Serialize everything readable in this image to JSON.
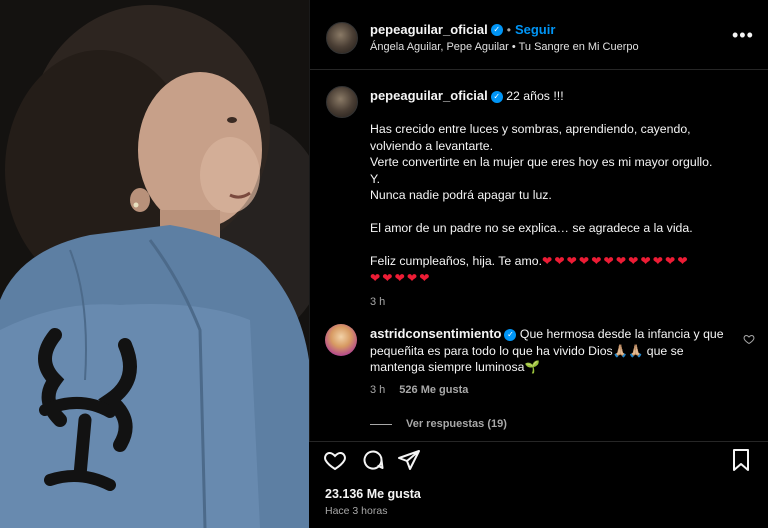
{
  "post": {
    "username": "pepeaguilar_oficial",
    "follow_label": "Seguir",
    "subline": "Ángela Aguilar, Pepe Aguilar • Tu Sangre en Mi Cuerpo",
    "more_label": "•••",
    "caption_lead": "22 años !!!",
    "caption_lines": [
      "Has crecido entre luces y sombras, aprendiendo, cayendo,",
      "volviendo a levantarte.",
      "Verte convertirte en la mujer que eres hoy es mi mayor orgullo.",
      "Y.",
      "Nunca nadie podrá apagar tu luz."
    ],
    "caption_line2": "El amor de un padre no se explica… se agradece a la vida.",
    "caption_line3": "Feliz cumpleaños, hija. Te amo.",
    "hearts_row1": "❤❤❤❤❤❤❤❤❤❤❤❤",
    "hearts_row2": "❤❤❤❤❤",
    "caption_time": "3 h",
    "likes": "23.136 Me gusta",
    "ago": "Hace 3 horas"
  },
  "comment": {
    "username": "astridconsentimiento",
    "text_line1": "Que hermosa desde la infancia y que",
    "text_line2": "pequeñita es para todo lo que ha vivido Dios🙏🏼🙏🏼 que se",
    "text_line3": "mantenga siempre luminosa🌱",
    "time": "3 h",
    "likes": "526 Me gusta",
    "replies_label": "Ver respuestas (19)"
  },
  "colors": {
    "accent_blue": "#0095f6",
    "heart_red": "#ed1c35",
    "muted_text": "#a8a8a8"
  },
  "icons": [
    "verified-badge-icon",
    "more-options-icon",
    "like-heart-icon",
    "comment-icon",
    "share-icon",
    "save-bookmark-icon",
    "comment-like-icon"
  ]
}
